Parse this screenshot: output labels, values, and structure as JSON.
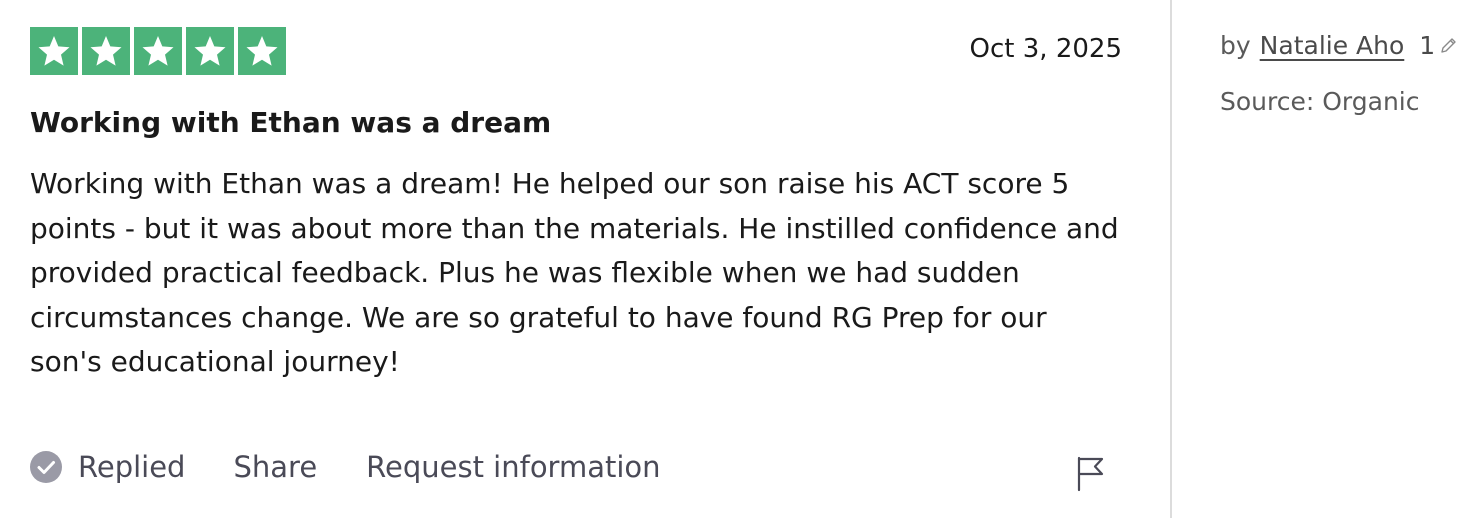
{
  "review": {
    "rating": 5,
    "max_rating": 5,
    "star_color": "#4cb37a",
    "date": "Oct 3, 2025",
    "title": "Working with Ethan was a dream",
    "body": "Working with Ethan was a dream! He helped our son raise his ACT score 5 points - but it was about more than the materials. He instilled confidence and provided practical feedback. Plus he was flexible when we had sudden circumstances change. We are so grateful to have found RG Prep for our son's educational journey!"
  },
  "actions": {
    "replied_label": "Replied",
    "share_label": "Share",
    "request_label": "Request information",
    "icons": [
      "check-circle-icon",
      "flag-icon"
    ]
  },
  "sidebar": {
    "by_prefix": "by",
    "author": "Natalie Aho",
    "review_count": "1",
    "count_icon": "pencil-icon",
    "source": "Source: Organic"
  }
}
